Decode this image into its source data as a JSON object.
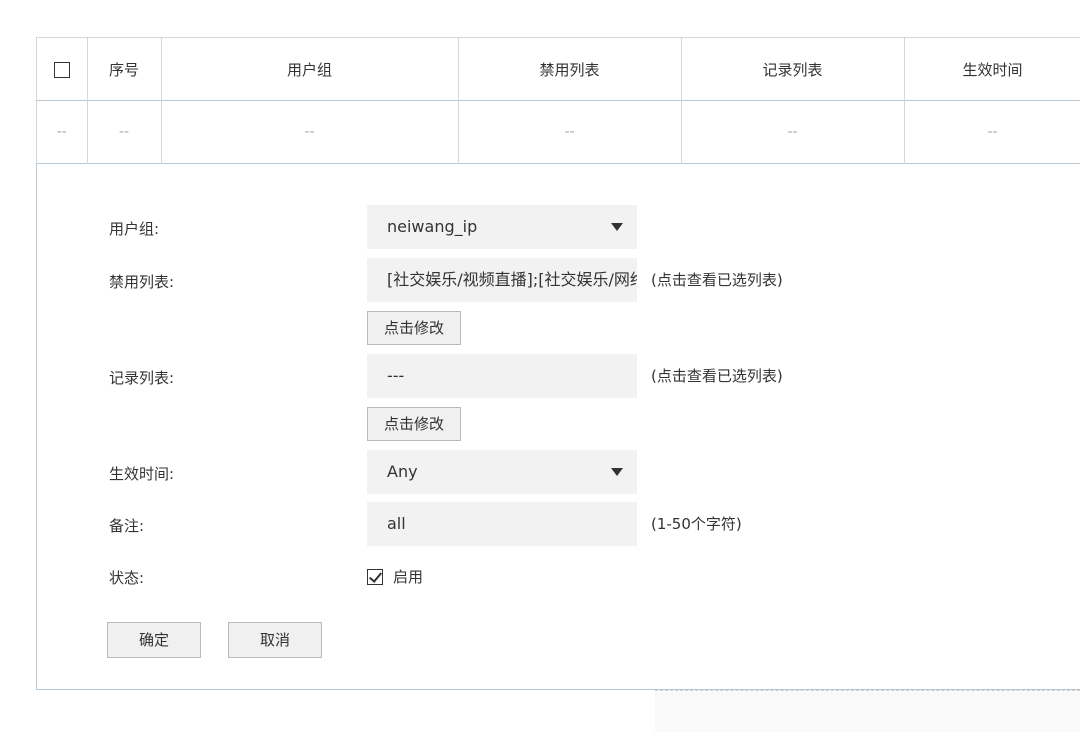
{
  "table": {
    "headers": [
      "序号",
      "用户组",
      "禁用列表",
      "记录列表",
      "生效时间"
    ],
    "row": [
      "--",
      "--",
      "--",
      "--",
      "--",
      "--"
    ]
  },
  "form": {
    "user_group_label": "用户组:",
    "user_group_value": "neiwang_ip",
    "ban_list_label": "禁用列表:",
    "ban_list_value": "[社交娱乐/视频直播];[社交娱乐/网络游戏]",
    "ban_list_hint": "(点击查看已选列表)",
    "modify_label": "点击修改",
    "record_list_label": "记录列表:",
    "record_list_value": "---",
    "record_list_hint": "(点击查看已选列表)",
    "effective_time_label": "生效时间:",
    "effective_time_value": "Any",
    "remark_label": "备注:",
    "remark_value": "all",
    "remark_hint": "(1-50个字符)",
    "status_label": "状态:",
    "status_enabled_label": "启用",
    "status_enabled": true
  },
  "buttons": {
    "confirm": "确定",
    "cancel": "取消"
  }
}
